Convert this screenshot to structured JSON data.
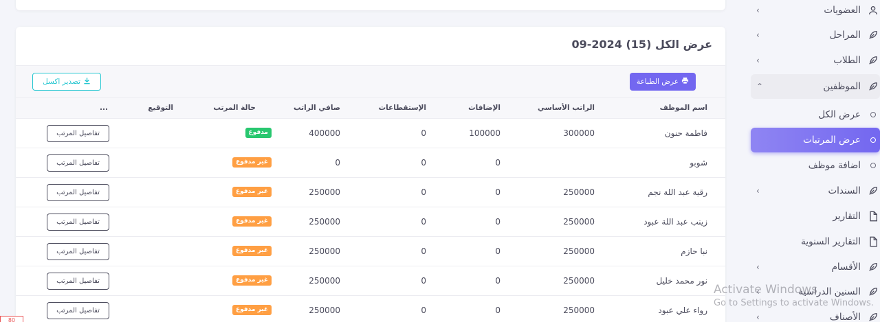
{
  "sidebar": {
    "items": [
      {
        "label": "العضويات",
        "icon": "user-icon",
        "chevron": "‹"
      },
      {
        "label": "المراحل",
        "icon": "feather-icon",
        "chevron": "‹"
      },
      {
        "label": "الطلاب",
        "icon": "feather-icon",
        "chevron": "‹"
      },
      {
        "label": "الموظفين",
        "icon": "feather-icon",
        "chevron": "⌃"
      },
      {
        "label": "عرض الكل",
        "icon": "circle-icon"
      },
      {
        "label": "عرض المرتبات",
        "icon": "circle-icon"
      },
      {
        "label": "اضافة موظف",
        "icon": "circle-icon"
      },
      {
        "label": "السندات",
        "icon": "feather-icon",
        "chevron": "‹"
      },
      {
        "label": "التقارير",
        "icon": "file-icon"
      },
      {
        "label": "التقارير السنوية",
        "icon": "file-icon"
      },
      {
        "label": "الأقسام",
        "icon": "feather-icon",
        "chevron": "‹"
      },
      {
        "label": "السنين الدراسية",
        "icon": "feather-icon",
        "chevron": "‹"
      },
      {
        "label": "الأصناف",
        "icon": "feather-icon",
        "chevron": "‹"
      }
    ]
  },
  "card": {
    "title": "عرض الكل (15) 2024-09",
    "print_label": "عرض الطباعة",
    "excel_label": "تصدير اكسل"
  },
  "table": {
    "headers": [
      "اسم الموظف",
      "الراتب الأساسي",
      "الإضافات",
      "الإستقطاعات",
      "صافي الراتب",
      "حالة المرتب",
      "التوقيع",
      "..."
    ],
    "details_label": "تفاصيل المرتب",
    "rows": [
      {
        "name": "فاطمة حنون",
        "basic": "300000",
        "additions": "100000",
        "deductions": "0",
        "net": "400000",
        "status": "مدفوع",
        "paid": true
      },
      {
        "name": "شوبو",
        "basic": "",
        "additions": "0",
        "deductions": "0",
        "net": "0",
        "status": "غير مدفوع",
        "paid": false
      },
      {
        "name": "رقية عبد اللة نجم",
        "basic": "250000",
        "additions": "0",
        "deductions": "0",
        "net": "250000",
        "status": "غير مدفوع",
        "paid": false
      },
      {
        "name": "زينب عبد اللة عبود",
        "basic": "250000",
        "additions": "0",
        "deductions": "0",
        "net": "250000",
        "status": "غير مدفوع",
        "paid": false
      },
      {
        "name": "نبا حازم",
        "basic": "250000",
        "additions": "0",
        "deductions": "0",
        "net": "250000",
        "status": "غير مدفوع",
        "paid": false
      },
      {
        "name": "نور محمد خليل",
        "basic": "250000",
        "additions": "0",
        "deductions": "0",
        "net": "250000",
        "status": "غير مدفوع",
        "paid": false
      },
      {
        "name": "رواء علي عبود",
        "basic": "250000",
        "additions": "0",
        "deductions": "0",
        "net": "250000",
        "status": "غير مدفوع",
        "paid": false
      }
    ]
  },
  "watermark": {
    "line1": "Activate Windows",
    "line2": "Go to Settings to activate Windows."
  },
  "corner": {
    "text": "80"
  },
  "colors": {
    "primary": "#7367f0",
    "success": "#28c76f",
    "warning": "#ff9f43",
    "info": "#28c7d1"
  }
}
